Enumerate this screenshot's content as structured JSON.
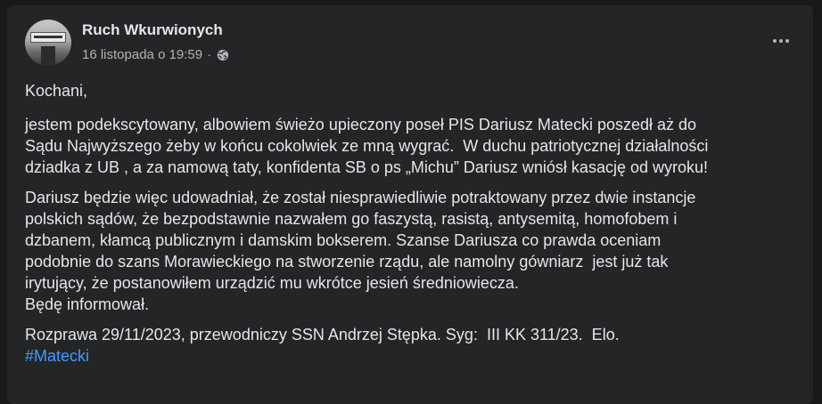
{
  "post": {
    "author": "Ruch Wkurwionych",
    "timestamp": "16 listopada o 19:59",
    "meta_separator": "·",
    "audience_icon": "globe-icon",
    "more_icon": "more-horizontal-icon",
    "avatar_icon": "page-avatar"
  },
  "content": {
    "greeting": "Kochani,",
    "p2": [
      "jestem podekscytowany, albowiem świeżo upieczony poseł PIS Dariusz Matecki poszedł aż do",
      "Sądu Najwyższego żeby w końcu cokolwiek ze mną wygrać.  W duchu patriotycznej działalności",
      "dziadka z UB , a za namową taty, konfidenta SB o ps „Michu” Dariusz wniósł kasację od wyroku!"
    ],
    "p3": [
      "Dariusz będzie więc udowadniał, że został niesprawiedliwie potraktowany przez dwie instancje",
      "polskich sądów, że bezpodstawnie nazwałem go faszystą, rasistą, antysemitą, homofobem i",
      "dzbanem, kłamcą publicznym i damskim bokserem. Szanse Dariusza co prawda oceniam",
      "podobnie do szans Morawieckiego na stworzenie rządu, ale namolny gówniarz  jest już tak",
      "irytujący, że postanowiłem urządzić mu wkrótce jesień średniowiecza.",
      "Będę informował."
    ],
    "p4": "Rozprawa 29/11/2023, przewodniczy SSN Andrzej Stępka. Syg:  III KK 311/23.  Elo.",
    "hashtag": "#Matecki"
  },
  "colors": {
    "background": "#18191a",
    "card": "#242526",
    "primary_text": "#e4e6eb",
    "secondary_text": "#b0b3b8",
    "link": "#4599ff"
  }
}
